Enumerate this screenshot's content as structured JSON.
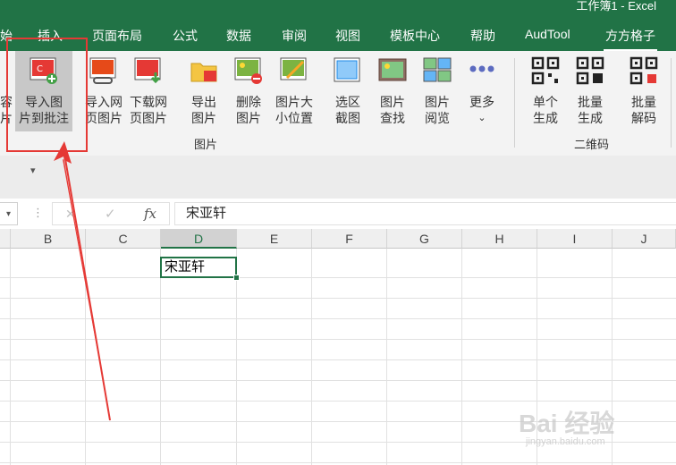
{
  "window": {
    "title": "工作簿1 - Excel"
  },
  "tabs": [
    {
      "label": "始",
      "active": false
    },
    {
      "label": "插入",
      "active": false
    },
    {
      "label": "页面布局",
      "active": false
    },
    {
      "label": "公式",
      "active": false
    },
    {
      "label": "数据",
      "active": false
    },
    {
      "label": "审阅",
      "active": false
    },
    {
      "label": "视图",
      "active": false
    },
    {
      "label": "模板中心",
      "active": false
    },
    {
      "label": "帮助",
      "active": false
    },
    {
      "label": "AudTool",
      "active": false
    },
    {
      "label": "方方格子",
      "active": true
    }
  ],
  "ribbon": {
    "partial_button": {
      "line1": "容",
      "line2": "片"
    },
    "buttons": [
      {
        "id": "import-to-comment",
        "line1": "导入图",
        "line2": "片到批注"
      },
      {
        "id": "import-web",
        "line1": "导入网",
        "line2": "页图片"
      },
      {
        "id": "download-web",
        "line1": "下载网",
        "line2": "页图片"
      },
      {
        "id": "export",
        "line1": "导出",
        "line2": "图片"
      },
      {
        "id": "delete",
        "line1": "删除",
        "line2": "图片"
      },
      {
        "id": "resize",
        "line1": "图片大",
        "line2": "小位置"
      },
      {
        "id": "screenshot",
        "line1": "选区",
        "line2": "截图"
      },
      {
        "id": "find",
        "line1": "图片",
        "line2": "查找"
      },
      {
        "id": "browse",
        "line1": "图片",
        "line2": "阅览"
      },
      {
        "id": "more",
        "line1": "更多",
        "line2": "⌄"
      },
      {
        "id": "single-qr",
        "line1": "单个",
        "line2": "生成"
      },
      {
        "id": "batch-qr",
        "line1": "批量",
        "line2": "生成"
      },
      {
        "id": "batch-decode",
        "line1": "批量",
        "line2": "解码"
      }
    ],
    "groups": {
      "pictures": "图片",
      "qrcode": "二维码"
    }
  },
  "formula_bar": {
    "value": "宋亚轩",
    "fx": "fx",
    "cancel": "✕",
    "confirm": "✓"
  },
  "columns": [
    "B",
    "C",
    "D",
    "E",
    "F",
    "G",
    "H",
    "I",
    "J"
  ],
  "selected_column": "D",
  "active_cell": {
    "value": "宋亚轩"
  },
  "watermark": {
    "main": "Bai 经验",
    "sub": "jingyan.baidu.com"
  }
}
